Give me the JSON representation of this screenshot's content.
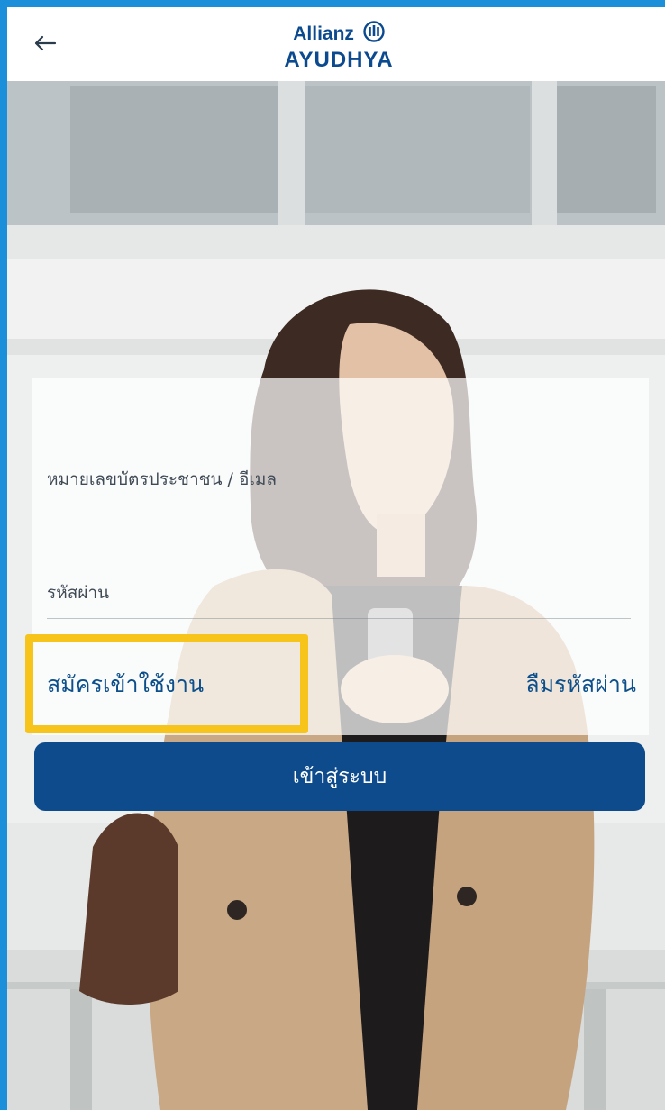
{
  "header": {
    "back_icon": "arrow-left-icon",
    "brand_line1": "Allianz",
    "brand_line2": "AYUDHYA",
    "brand_mark_icon": "allianz-eagle-mark-icon",
    "brand_color": "#0c4a8f"
  },
  "login": {
    "id_placeholder": "หมายเลขบัตรประชาชน / อีเมล",
    "id_value": "",
    "password_placeholder": "รหัสผ่าน",
    "password_value": "",
    "register_label": "สมัครเข้าใช้งาน",
    "forgot_label": "ลืมรหัสผ่าน",
    "submit_label": "เข้าสู่ระบบ"
  },
  "colors": {
    "accent": "#0e4b8c",
    "link": "#0d4f8b",
    "highlight": "#f6c41b",
    "frame": "#1b8fd9"
  }
}
